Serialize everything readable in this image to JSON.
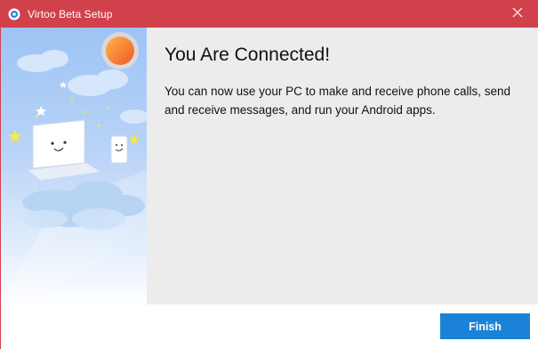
{
  "window": {
    "title": "Virtoo Beta Setup",
    "accent_color": "#d1414c",
    "icons": {
      "app": "virtoo-app-icon",
      "close": "close-icon"
    }
  },
  "main": {
    "heading": "You Are Connected!",
    "message": "You can now use your PC to make and receive phone calls, send and receive messages, and run your Android apps."
  },
  "illustration": {
    "description_icons": [
      "sun-icon",
      "cloud-icon",
      "laptop-icon",
      "phone-icon",
      "star-icon"
    ]
  },
  "footer": {
    "finish_label": "Finish",
    "button_color": "#1b83d7"
  }
}
